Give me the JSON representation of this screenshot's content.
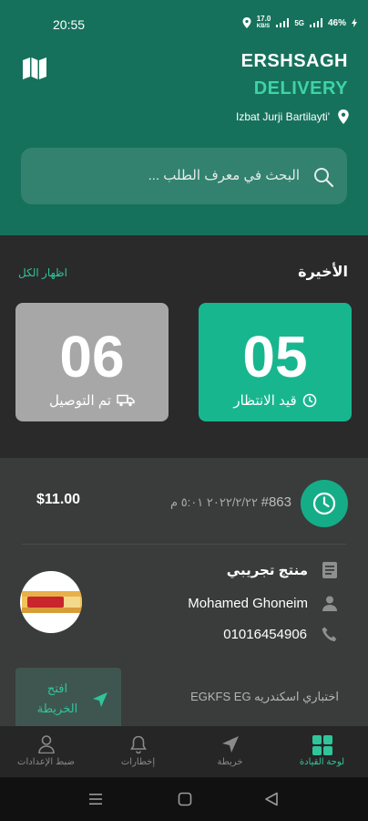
{
  "status_bar": {
    "time": "20:55",
    "speed": "17.0",
    "speed_unit": "KB/S",
    "network": "5G",
    "battery": "46%"
  },
  "header": {
    "brand_line1": "ERSHSAGH",
    "brand_line2": "DELIVERY",
    "location": "Izbat Jurji Bartilayti'",
    "search_placeholder": "البحث في معرف الطلب ...",
    "brand_color": "#3fd3a7",
    "background_color": "#16715c"
  },
  "recent": {
    "title": "الأخيرة",
    "show_all": "اظهار الكل",
    "pending": {
      "count": "05",
      "label": "قيد الانتظار",
      "color": "#18b68f"
    },
    "delivered": {
      "count": "06",
      "label": "تم التوصيل",
      "color": "#a7a7a7"
    }
  },
  "order": {
    "id": "#863",
    "datetime": "٢٠٢٢/٢/٢٢ ٥:٠١ م",
    "price": "$11.00",
    "product": "منتج تجريبي",
    "customer": "Mohamed Ghoneim",
    "phone": "01016454906",
    "open_map": "افتح الخريطة",
    "address": "اختباري اسكندريه EGKFS EG"
  },
  "bottom_nav": {
    "items": [
      {
        "label": "لوحة القيادة",
        "icon": "dashboard-icon",
        "active": true
      },
      {
        "label": "خريطة",
        "icon": "navigation-icon",
        "active": false
      },
      {
        "label": "إخطارات",
        "icon": "bell-icon",
        "active": false
      },
      {
        "label": "ضبط الإعدادات",
        "icon": "person-icon",
        "active": false
      }
    ]
  }
}
